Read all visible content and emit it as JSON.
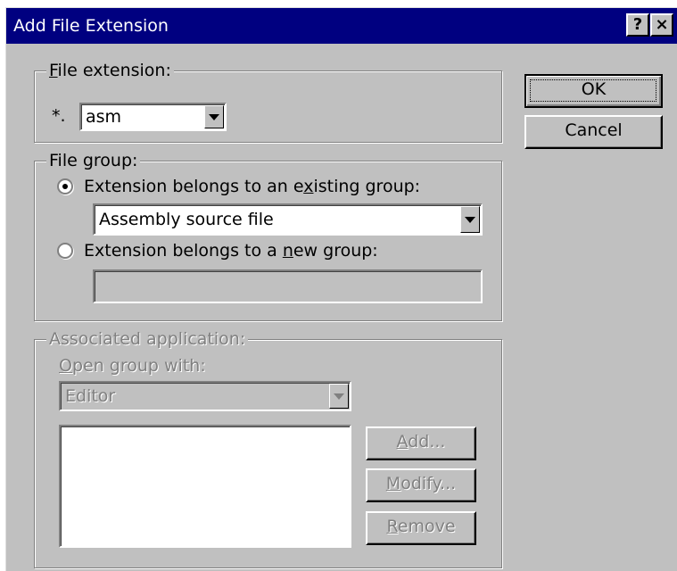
{
  "window": {
    "title": "Add File Extension",
    "help_label": "?",
    "close_label": "×"
  },
  "file_extension": {
    "legend_mnemonic": "F",
    "legend_rest": "ile extension:",
    "prefix": "*.",
    "value": "asm"
  },
  "file_group": {
    "legend": "File group:",
    "existing_radio": {
      "pre": "Extension belongs to an e",
      "mnemonic": "x",
      "post": "isting group:",
      "selected": true
    },
    "existing_value": "Assembly source file",
    "new_radio": {
      "pre": "Extension belongs to a ",
      "mnemonic": "n",
      "post": "ew group:",
      "selected": false
    },
    "new_value": ""
  },
  "associated_application": {
    "legend": "Associated application:",
    "open_with_mnemonic": "O",
    "open_with_rest": "pen group with:",
    "open_with_value": "Editor",
    "add": {
      "mnemonic": "A",
      "rest": "dd..."
    },
    "modify": {
      "mnemonic": "M",
      "rest": "odify..."
    },
    "remove": {
      "mnemonic": "R",
      "rest": "emove"
    }
  },
  "buttons": {
    "ok": "OK",
    "cancel": "Cancel"
  }
}
